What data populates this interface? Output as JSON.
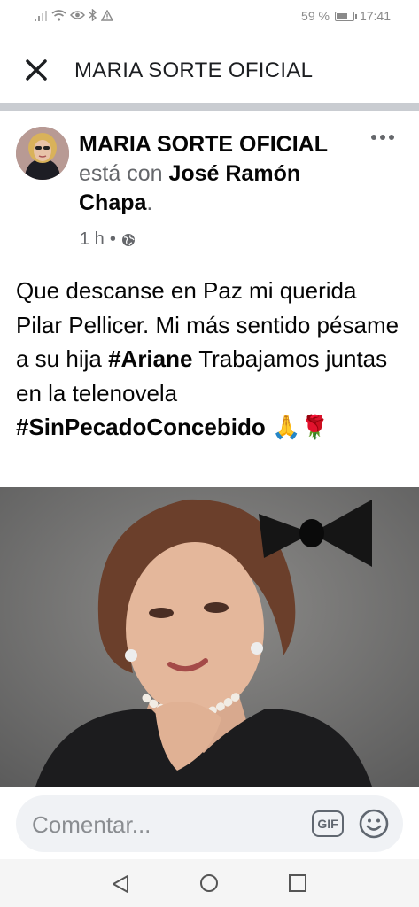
{
  "status_bar": {
    "battery_text": "59 %",
    "battery_level": 0.59,
    "time": "17:41",
    "icons": [
      "signal-icon",
      "wifi-icon",
      "eye-icon",
      "bluetooth-icon",
      "warning-icon"
    ]
  },
  "header": {
    "title": "MARIA SORTE OFICIAL",
    "close_icon": "close-icon"
  },
  "post": {
    "author": "MARIA SORTE OFICIAL",
    "with_text": " está con ",
    "tagged_person": "José Ramón Chapa",
    "period": ".",
    "time": "1 h",
    "separator": "•",
    "privacy_icon": "globe-icon",
    "text": {
      "line_a": "Que  descanse en Paz mi querida Pilar Pellicer. Mi más sentido pésame a su hija ",
      "hashtag_1": "#Ariane",
      "line_b": " Trabajamos juntas en la telenovela ",
      "hashtag_2": "#SinPecadoConcebido",
      "emoji": " 🙏🌹"
    },
    "colors": {
      "accent": "#050505",
      "secondary": "#65676b"
    }
  },
  "comment_bar": {
    "placeholder": "Comentar...",
    "gif_label": "GIF",
    "emoji_icon": "smiley-icon"
  },
  "nav_bar": {
    "icons": [
      "back-icon",
      "home-icon",
      "recent-apps-icon"
    ]
  }
}
